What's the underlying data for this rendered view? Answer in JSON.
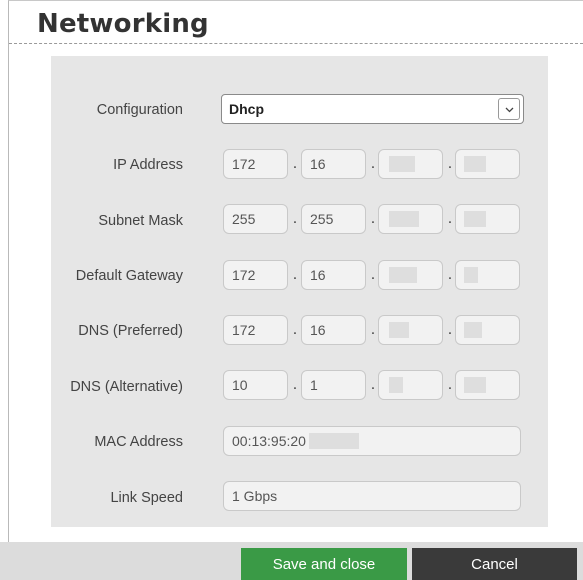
{
  "dialog": {
    "title": "Networking"
  },
  "form": {
    "configuration": {
      "label": "Configuration",
      "value": "Dhcp"
    },
    "ip_address": {
      "label": "IP Address",
      "octets": [
        "172",
        "16",
        "",
        ""
      ]
    },
    "subnet_mask": {
      "label": "Subnet Mask",
      "octets": [
        "255",
        "255",
        "",
        ""
      ]
    },
    "default_gateway": {
      "label": "Default Gateway",
      "octets": [
        "172",
        "16",
        "",
        ""
      ]
    },
    "dns_preferred": {
      "label": "DNS (Preferred)",
      "octets": [
        "172",
        "16",
        "",
        ""
      ]
    },
    "dns_alternative": {
      "label": "DNS (Alternative)",
      "octets": [
        "10",
        "1",
        "",
        ""
      ]
    },
    "mac_address": {
      "label": "MAC Address",
      "value": "00:13:95:20"
    },
    "link_speed": {
      "label": "Link Speed",
      "value": "1 Gbps"
    },
    "separator": "."
  },
  "footer": {
    "save_label": "Save and close",
    "cancel_label": "Cancel"
  },
  "icons": {
    "dropdown": "chevron-down-icon"
  },
  "colors": {
    "save": "#3a9a46",
    "cancel": "#3a3a3a",
    "panel": "#e6e6e6"
  }
}
